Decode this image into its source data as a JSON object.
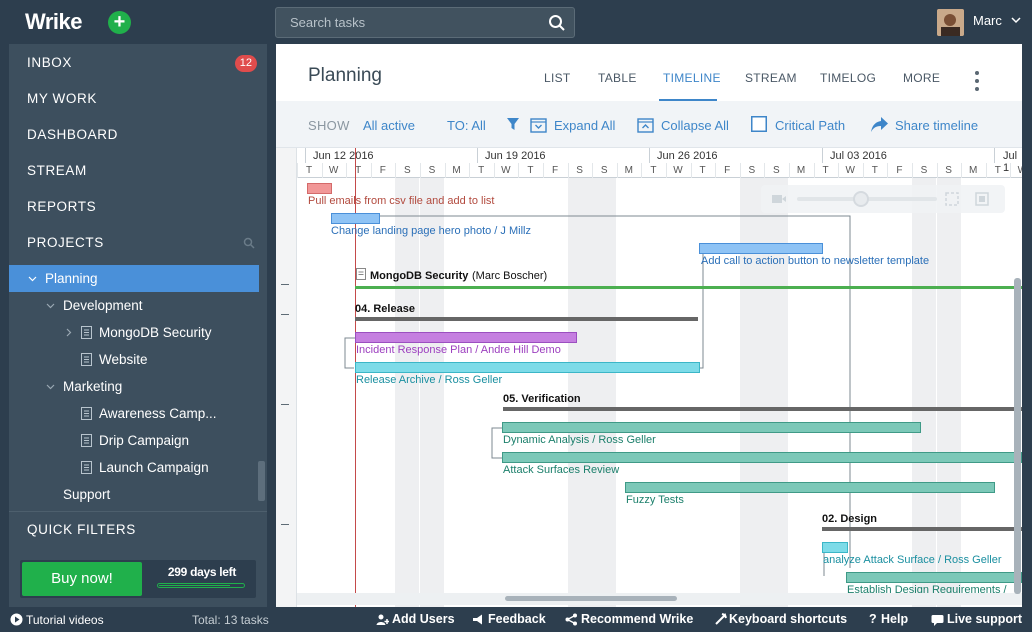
{
  "brand": {
    "logo": "Wrike",
    "add_symbol": "+",
    "colors": {
      "dark": "#2d3e4e",
      "accent": "#4a90d9",
      "green": "#20b04b"
    }
  },
  "search": {
    "placeholder": "Search tasks"
  },
  "user": {
    "name": "Marc"
  },
  "sidebar": {
    "nav": [
      {
        "label": "INBOX",
        "badge": "12"
      },
      {
        "label": "MY WORK"
      },
      {
        "label": "DASHBOARD"
      },
      {
        "label": "STREAM"
      },
      {
        "label": "REPORTS"
      },
      {
        "label": "PROJECTS"
      }
    ],
    "tree": [
      {
        "label": "Planning"
      },
      {
        "label": "Development"
      },
      {
        "label": "MongoDB Security"
      },
      {
        "label": "Website"
      },
      {
        "label": "Marketing"
      },
      {
        "label": "Awareness Camp..."
      },
      {
        "label": "Drip Campaign"
      },
      {
        "label": "Launch Campaign"
      },
      {
        "label": "Support"
      }
    ],
    "quick_filters": "QUICK FILTERS",
    "trial": {
      "buy_label": "Buy now!",
      "days_left": "299 days left",
      "fraction_left": 0.82
    }
  },
  "main": {
    "title": "Planning",
    "tabs": [
      "LIST",
      "TABLE",
      "TIMELINE",
      "STREAM",
      "TIMELOG",
      "MORE"
    ],
    "toolbar": {
      "show_label": "SHOW",
      "show_value": "All active",
      "to_value": "TO: All",
      "expand": "Expand All",
      "collapse": "Collapse All",
      "critical": "Critical Path",
      "share": "Share timeline"
    }
  },
  "gantt": {
    "weeks": [
      "Jun 12 2016",
      "Jun 19 2016",
      "Jun 26 2016",
      "Jul 03 2016",
      "Jul 1"
    ],
    "days": [
      "T",
      "W",
      "T",
      "F",
      "S",
      "S",
      "M",
      "T",
      "W",
      "T",
      "F",
      "S",
      "S",
      "M",
      "T",
      "W",
      "T",
      "F",
      "S",
      "S",
      "M",
      "T",
      "W",
      "T",
      "F",
      "S",
      "S",
      "M",
      "T",
      "W"
    ],
    "tasks": {
      "t1": "Pull emails from csv file and add to list",
      "t2": "Change landing page hero photo / J Millz",
      "t3": "Add call to action button to newsletter template",
      "project_name": "MongoDB Security",
      "project_owner": "(Marc Boscher)",
      "g1": "04. Release",
      "t4": "Incident Response Plan / Andre Hill Demo",
      "t5": "Release Archive / Ross Geller",
      "g2": "05. Verification",
      "t6": "Dynamic Analysis / Ross Geller",
      "t7": "Attack Surfaces Review",
      "t8": "Fuzzy Tests",
      "g3": "02. Design",
      "t9": "analyze Attack Surface / Ross Geller",
      "t10": "Establish Design Requirements /"
    },
    "colors": {
      "red": "#f19797",
      "blue": "#8ec3f5",
      "purple": "#c57fe0",
      "cyan": "#7ddbe8",
      "teal": "#7cc8b8",
      "green_line": "#4caf50"
    }
  },
  "footer": {
    "tutorial": "Tutorial videos",
    "total": "Total: 13 tasks",
    "add_users": "Add Users",
    "feedback": "Feedback",
    "recommend": "Recommend Wrike",
    "shortcuts": "Keyboard shortcuts",
    "help": "Help",
    "support": "Live support"
  }
}
